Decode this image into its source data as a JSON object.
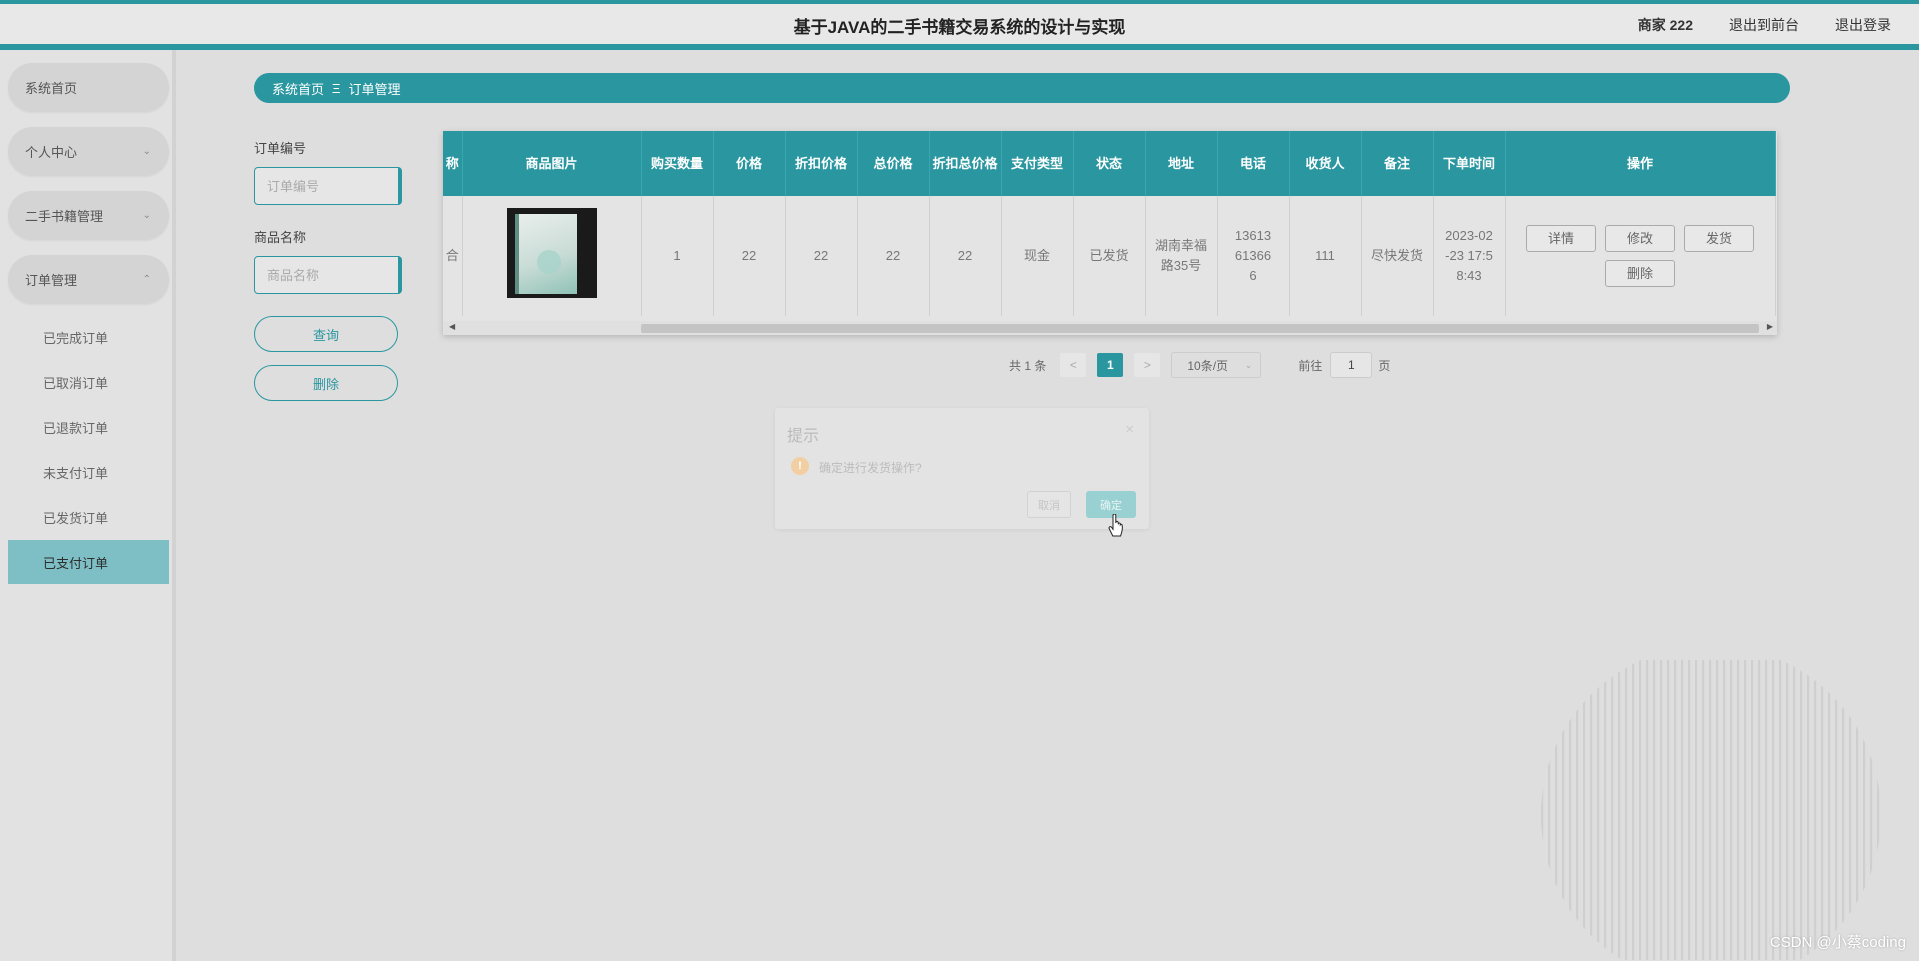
{
  "header": {
    "title": "基于JAVA的二手书籍交易系统的设计与实现",
    "user": "商家 222",
    "back_to_front": "退出到前台",
    "logout": "退出登录"
  },
  "sidebar": {
    "items": [
      {
        "label": "系统首页"
      },
      {
        "label": "个人中心"
      },
      {
        "label": "二手书籍管理"
      },
      {
        "label": "订单管理"
      }
    ],
    "sub_items": [
      {
        "label": "已完成订单"
      },
      {
        "label": "已取消订单"
      },
      {
        "label": "已退款订单"
      },
      {
        "label": "未支付订单"
      },
      {
        "label": "已发货订单"
      },
      {
        "label": "已支付订单"
      }
    ]
  },
  "breadcrumb": {
    "home": "系统首页",
    "sep": "Ξ",
    "current": "订单管理"
  },
  "search": {
    "order_no_label": "订单编号",
    "order_no_placeholder": "订单编号",
    "product_name_label": "商品名称",
    "product_name_placeholder": "商品名称",
    "query_button": "查询",
    "delete_button": "删除"
  },
  "table": {
    "columns": [
      "称",
      "商品图片",
      "购买数量",
      "价格",
      "折扣价格",
      "总价格",
      "折扣总价格",
      "支付类型",
      "状态",
      "地址",
      "电话",
      "收货人",
      "备注",
      "下单时间",
      "操作"
    ],
    "rows": [
      {
        "name_partial": "合",
        "quantity": "1",
        "price": "22",
        "discount_price": "22",
        "total_price": "22",
        "discount_total": "22",
        "pay_type": "现金",
        "status": "已发货",
        "address": "湖南幸福路35号",
        "phone": "13613613666",
        "receiver": "111",
        "remark": "尽快发货",
        "order_time": "2023-02-23 17:58:43",
        "actions": [
          "详情",
          "修改",
          "发货",
          "删除"
        ]
      }
    ]
  },
  "pagination": {
    "total_text": "共 1 条",
    "prev": "<",
    "current_page": "1",
    "next": ">",
    "page_size": "10条/页",
    "goto_label": "前往",
    "goto_value": "1",
    "page_unit": "页"
  },
  "dialog": {
    "title": "提示",
    "close": "×",
    "message": "确定进行发货操作?",
    "cancel": "取消",
    "confirm": "确定"
  },
  "watermark": "CSDN @小蔡coding",
  "colors": {
    "accent": "#2a97a0",
    "active_menu": "#7dbfc5",
    "warning": "#f1cfa3"
  }
}
